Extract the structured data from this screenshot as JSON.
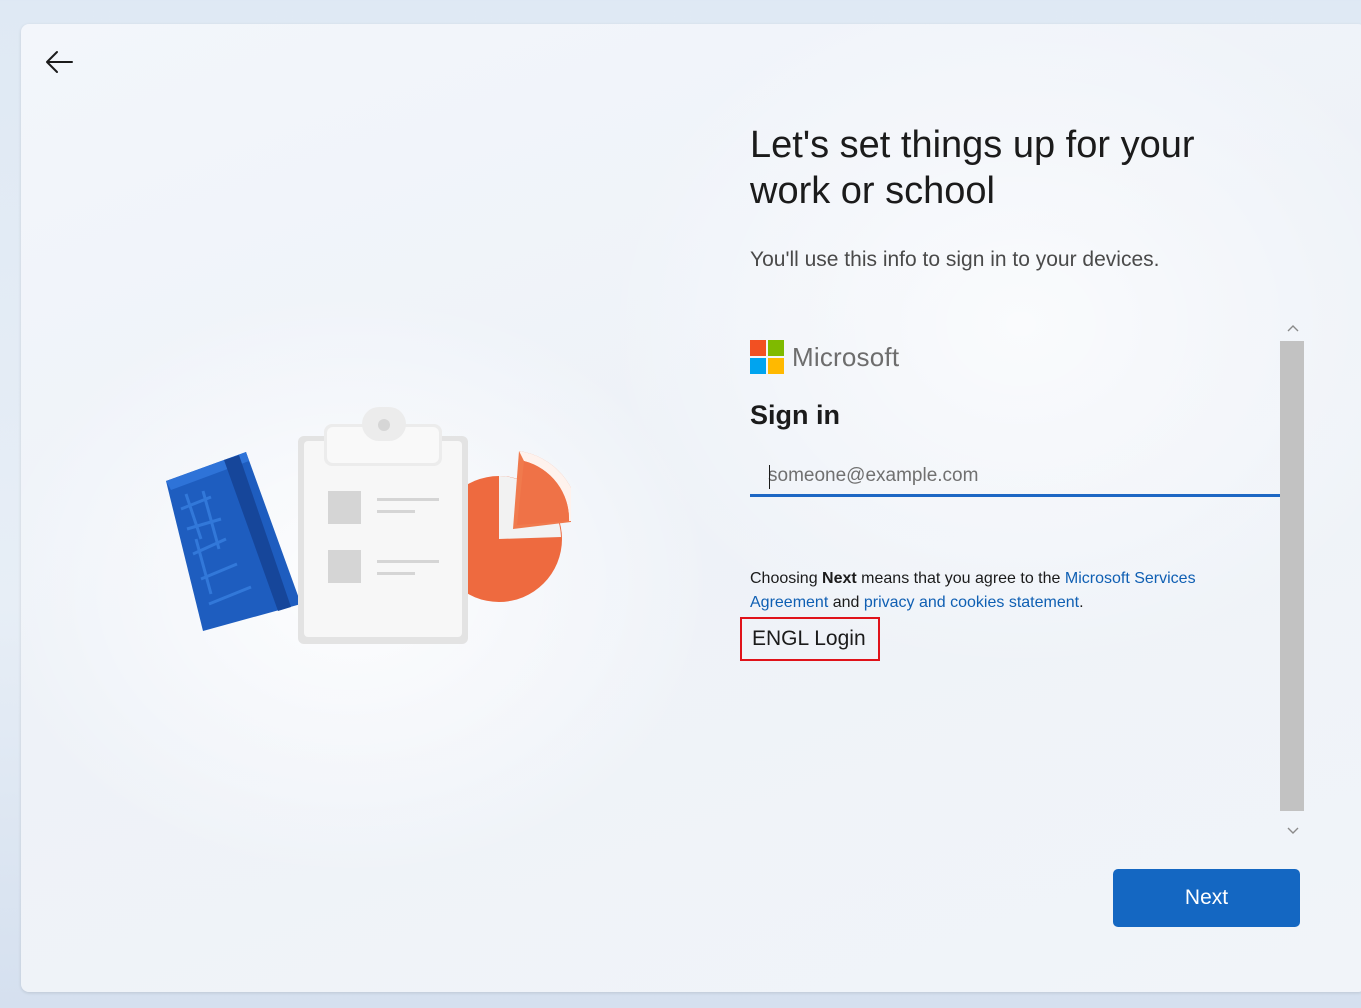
{
  "page": {
    "title": "Let's set things up for your work or school",
    "subtitle": "You'll use this info to sign in to your devices."
  },
  "nav": {
    "back_icon": "arrow-left-icon"
  },
  "illustration": {
    "name": "notebook-clipboard-pie-illustration",
    "colors": {
      "notebook": "#1b5fc4",
      "clipboard": "#f7f7f7",
      "pie": "#ee6a3f"
    }
  },
  "signin": {
    "brand": "Microsoft",
    "brand_colors": [
      "#f25022",
      "#7fba00",
      "#00a4ef",
      "#ffb900"
    ],
    "heading": "Sign in",
    "email_placeholder": "someone@example.com",
    "email_value": "",
    "agreement": {
      "prefix": "Choosing ",
      "bold": "Next",
      "middle": " means that you agree to the ",
      "link1": "Microsoft Services Agreement",
      "and": " and ",
      "link2": "privacy and cookies statement",
      "suffix": "."
    },
    "alt_login": "ENGL Login"
  },
  "scrollbar": {
    "up_icon": "chevron-up-icon",
    "down_icon": "chevron-down-icon"
  },
  "actions": {
    "next_label": "Next"
  },
  "colors": {
    "accent": "#1467c2",
    "link": "#0f5fb3",
    "highlight_border": "#e0121a"
  }
}
